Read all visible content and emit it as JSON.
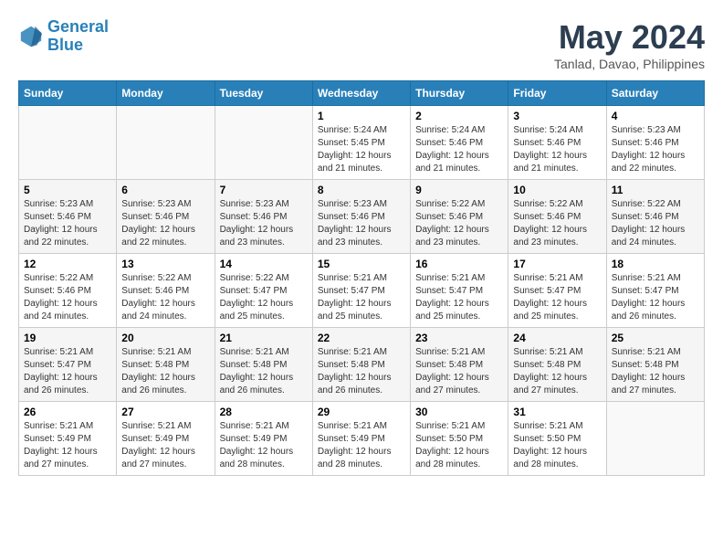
{
  "header": {
    "logo_line1": "General",
    "logo_line2": "Blue",
    "month_title": "May 2024",
    "subtitle": "Tanlad, Davao, Philippines"
  },
  "days_of_week": [
    "Sunday",
    "Monday",
    "Tuesday",
    "Wednesday",
    "Thursday",
    "Friday",
    "Saturday"
  ],
  "weeks": [
    [
      {
        "day": "",
        "info": ""
      },
      {
        "day": "",
        "info": ""
      },
      {
        "day": "",
        "info": ""
      },
      {
        "day": "1",
        "info": "Sunrise: 5:24 AM\nSunset: 5:45 PM\nDaylight: 12 hours\nand 21 minutes."
      },
      {
        "day": "2",
        "info": "Sunrise: 5:24 AM\nSunset: 5:46 PM\nDaylight: 12 hours\nand 21 minutes."
      },
      {
        "day": "3",
        "info": "Sunrise: 5:24 AM\nSunset: 5:46 PM\nDaylight: 12 hours\nand 21 minutes."
      },
      {
        "day": "4",
        "info": "Sunrise: 5:23 AM\nSunset: 5:46 PM\nDaylight: 12 hours\nand 22 minutes."
      }
    ],
    [
      {
        "day": "5",
        "info": "Sunrise: 5:23 AM\nSunset: 5:46 PM\nDaylight: 12 hours\nand 22 minutes."
      },
      {
        "day": "6",
        "info": "Sunrise: 5:23 AM\nSunset: 5:46 PM\nDaylight: 12 hours\nand 22 minutes."
      },
      {
        "day": "7",
        "info": "Sunrise: 5:23 AM\nSunset: 5:46 PM\nDaylight: 12 hours\nand 23 minutes."
      },
      {
        "day": "8",
        "info": "Sunrise: 5:23 AM\nSunset: 5:46 PM\nDaylight: 12 hours\nand 23 minutes."
      },
      {
        "day": "9",
        "info": "Sunrise: 5:22 AM\nSunset: 5:46 PM\nDaylight: 12 hours\nand 23 minutes."
      },
      {
        "day": "10",
        "info": "Sunrise: 5:22 AM\nSunset: 5:46 PM\nDaylight: 12 hours\nand 23 minutes."
      },
      {
        "day": "11",
        "info": "Sunrise: 5:22 AM\nSunset: 5:46 PM\nDaylight: 12 hours\nand 24 minutes."
      }
    ],
    [
      {
        "day": "12",
        "info": "Sunrise: 5:22 AM\nSunset: 5:46 PM\nDaylight: 12 hours\nand 24 minutes."
      },
      {
        "day": "13",
        "info": "Sunrise: 5:22 AM\nSunset: 5:46 PM\nDaylight: 12 hours\nand 24 minutes."
      },
      {
        "day": "14",
        "info": "Sunrise: 5:22 AM\nSunset: 5:47 PM\nDaylight: 12 hours\nand 25 minutes."
      },
      {
        "day": "15",
        "info": "Sunrise: 5:21 AM\nSunset: 5:47 PM\nDaylight: 12 hours\nand 25 minutes."
      },
      {
        "day": "16",
        "info": "Sunrise: 5:21 AM\nSunset: 5:47 PM\nDaylight: 12 hours\nand 25 minutes."
      },
      {
        "day": "17",
        "info": "Sunrise: 5:21 AM\nSunset: 5:47 PM\nDaylight: 12 hours\nand 25 minutes."
      },
      {
        "day": "18",
        "info": "Sunrise: 5:21 AM\nSunset: 5:47 PM\nDaylight: 12 hours\nand 26 minutes."
      }
    ],
    [
      {
        "day": "19",
        "info": "Sunrise: 5:21 AM\nSunset: 5:47 PM\nDaylight: 12 hours\nand 26 minutes."
      },
      {
        "day": "20",
        "info": "Sunrise: 5:21 AM\nSunset: 5:48 PM\nDaylight: 12 hours\nand 26 minutes."
      },
      {
        "day": "21",
        "info": "Sunrise: 5:21 AM\nSunset: 5:48 PM\nDaylight: 12 hours\nand 26 minutes."
      },
      {
        "day": "22",
        "info": "Sunrise: 5:21 AM\nSunset: 5:48 PM\nDaylight: 12 hours\nand 26 minutes."
      },
      {
        "day": "23",
        "info": "Sunrise: 5:21 AM\nSunset: 5:48 PM\nDaylight: 12 hours\nand 27 minutes."
      },
      {
        "day": "24",
        "info": "Sunrise: 5:21 AM\nSunset: 5:48 PM\nDaylight: 12 hours\nand 27 minutes."
      },
      {
        "day": "25",
        "info": "Sunrise: 5:21 AM\nSunset: 5:48 PM\nDaylight: 12 hours\nand 27 minutes."
      }
    ],
    [
      {
        "day": "26",
        "info": "Sunrise: 5:21 AM\nSunset: 5:49 PM\nDaylight: 12 hours\nand 27 minutes."
      },
      {
        "day": "27",
        "info": "Sunrise: 5:21 AM\nSunset: 5:49 PM\nDaylight: 12 hours\nand 27 minutes."
      },
      {
        "day": "28",
        "info": "Sunrise: 5:21 AM\nSunset: 5:49 PM\nDaylight: 12 hours\nand 28 minutes."
      },
      {
        "day": "29",
        "info": "Sunrise: 5:21 AM\nSunset: 5:49 PM\nDaylight: 12 hours\nand 28 minutes."
      },
      {
        "day": "30",
        "info": "Sunrise: 5:21 AM\nSunset: 5:50 PM\nDaylight: 12 hours\nand 28 minutes."
      },
      {
        "day": "31",
        "info": "Sunrise: 5:21 AM\nSunset: 5:50 PM\nDaylight: 12 hours\nand 28 minutes."
      },
      {
        "day": "",
        "info": ""
      }
    ]
  ]
}
